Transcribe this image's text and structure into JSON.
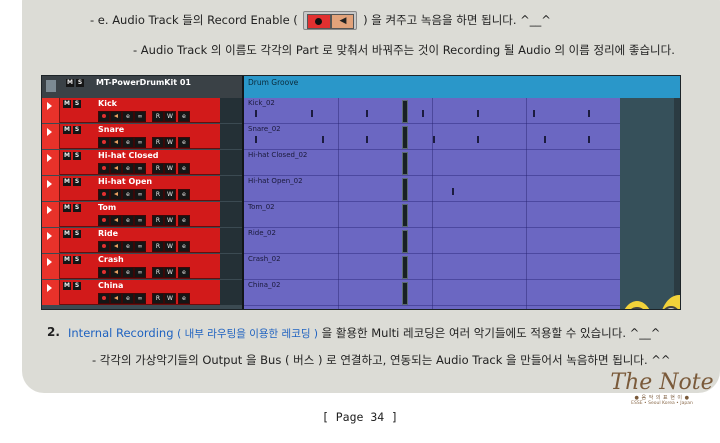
{
  "line1": {
    "before": "- e. Audio Track 들의 Record Enable (",
    "after": ") 을 켜주고 녹음을 하면 됩니다. ^__^"
  },
  "line2": "- Audio Track 의 이름도 각각의 Part 로 맞춰서 바꿔주는 것이 Recording 될 Audio 의 이름 정리에 좋습니다.",
  "daw": {
    "kit_name": "MT-PowerDrumKit 01",
    "part_name": "Drum Groove",
    "button_labels": {
      "mute": "M",
      "solo": "S",
      "read": "R",
      "write": "W",
      "edit": "e",
      "link": "∞"
    },
    "tracks": [
      {
        "name": "Kick",
        "part": "Kick_02"
      },
      {
        "name": "Snare",
        "part": "Snare_02"
      },
      {
        "name": "Hi-hat Closed",
        "part": "Hi-hat Closed_02"
      },
      {
        "name": "Hi-hat Open",
        "part": "Hi-hat Open_02"
      },
      {
        "name": "Tom",
        "part": "Tom_02"
      },
      {
        "name": "Ride",
        "part": "Ride_02"
      },
      {
        "name": "Crash",
        "part": "Crash_02"
      },
      {
        "name": "China",
        "part": "China_02"
      }
    ],
    "colors": {
      "track": "#d21a1a",
      "lane": "#6b67c2",
      "ruler": "#2a97c9"
    }
  },
  "section2": {
    "number": "2.",
    "title": "Internal Recording",
    "subtitle": "( 내부 라우팅을 이용한 레코딩 )",
    "rest": "을 활용한 Multi 레코딩은 여러 악기들에도 적용할 수 있습니다. ^__^"
  },
  "line4": "- 각각의 가상악기들의 Output 을 Bus ( 버스 ) 로 연결하고, 연동되는 Audio Track 을 만들어서 녹음하면 됩니다. ^^",
  "footer": "[ Page 34 ]",
  "logo": {
    "main": "The Note",
    "sub": "● 음 악 의 표 현 이 ●",
    "sub2": "ESSE • Seoul Korea • Japan"
  }
}
